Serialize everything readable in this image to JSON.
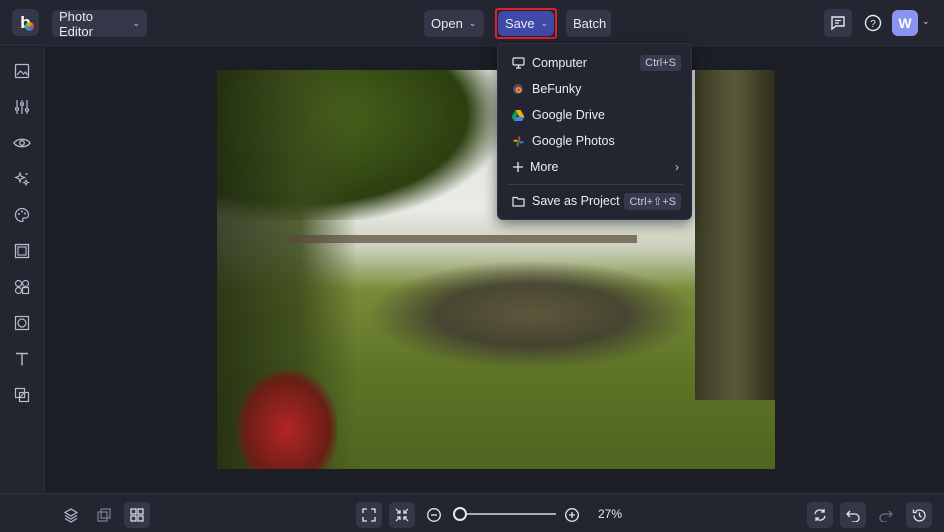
{
  "topbar": {
    "app_label": "Photo Editor",
    "open_label": "Open",
    "save_label": "Save",
    "batch_label": "Batch",
    "avatar_initial": "W"
  },
  "save_menu": {
    "items": [
      {
        "icon": "monitor-icon",
        "label": "Computer",
        "shortcut": "Ctrl+S"
      },
      {
        "icon": "befunky-icon",
        "label": "BeFunky",
        "shortcut": ""
      },
      {
        "icon": "google-drive-icon",
        "label": "Google Drive",
        "shortcut": ""
      },
      {
        "icon": "google-photos-icon",
        "label": "Google Photos",
        "shortcut": ""
      },
      {
        "icon": "plus-icon",
        "label": "More",
        "shortcut": "",
        "submenu": true
      },
      {
        "icon": "folder-icon",
        "label": "Save as Project",
        "shortcut": "Ctrl+⇧+S"
      }
    ]
  },
  "sidebar": {
    "items": [
      "image-icon",
      "sliders-icon",
      "eye-icon",
      "sparkles-icon",
      "palette-icon",
      "frame-icon",
      "shapes-icon",
      "texture-icon",
      "text-icon",
      "graphics-icon"
    ]
  },
  "bottombar": {
    "zoom_percent": "27%",
    "zoom_value": 27
  },
  "colors": {
    "accent": "#3f4aa8",
    "highlight_outline": "#e2202a",
    "avatar": "#8a93f0"
  }
}
